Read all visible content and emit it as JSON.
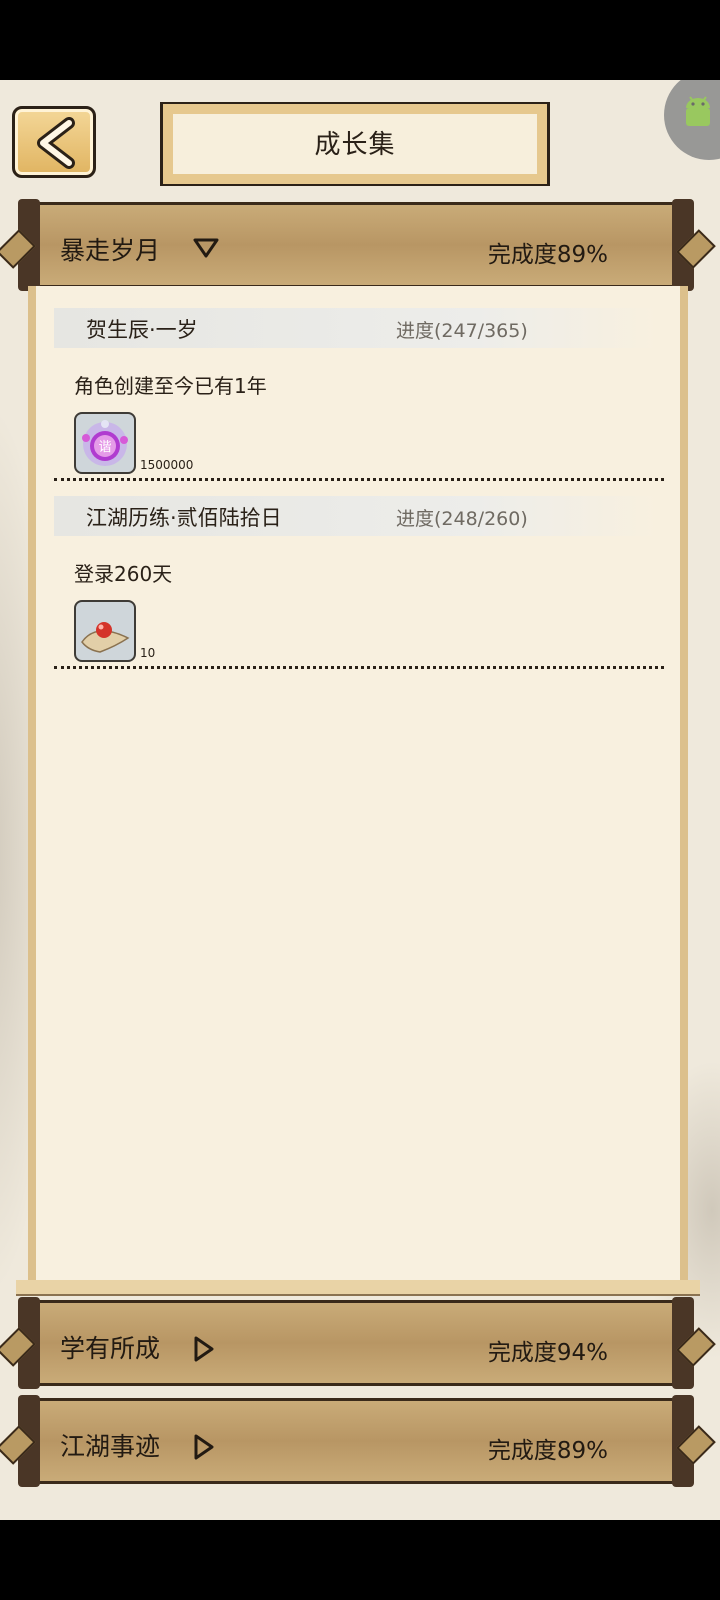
{
  "header": {
    "title": "成长集"
  },
  "categories": [
    {
      "name": "暴走岁月",
      "completion": "完成度89%",
      "expanded": true
    },
    {
      "name": "学有所成",
      "completion": "完成度94%",
      "expanded": false
    },
    {
      "name": "江湖事迹",
      "completion": "完成度89%",
      "expanded": false
    }
  ],
  "achievements": [
    {
      "name": "贺生辰·一岁",
      "progress": "进度(247/365)",
      "description": "角色创建至今已有1年",
      "reward_icon": "purple-talisman-icon",
      "reward_count": "1500000"
    },
    {
      "name": "江湖历练·贰佰陆拾日",
      "progress": "进度(248/260)",
      "description": "登录260天",
      "reward_icon": "red-pearl-scroll-icon",
      "reward_count": "10"
    }
  ]
}
